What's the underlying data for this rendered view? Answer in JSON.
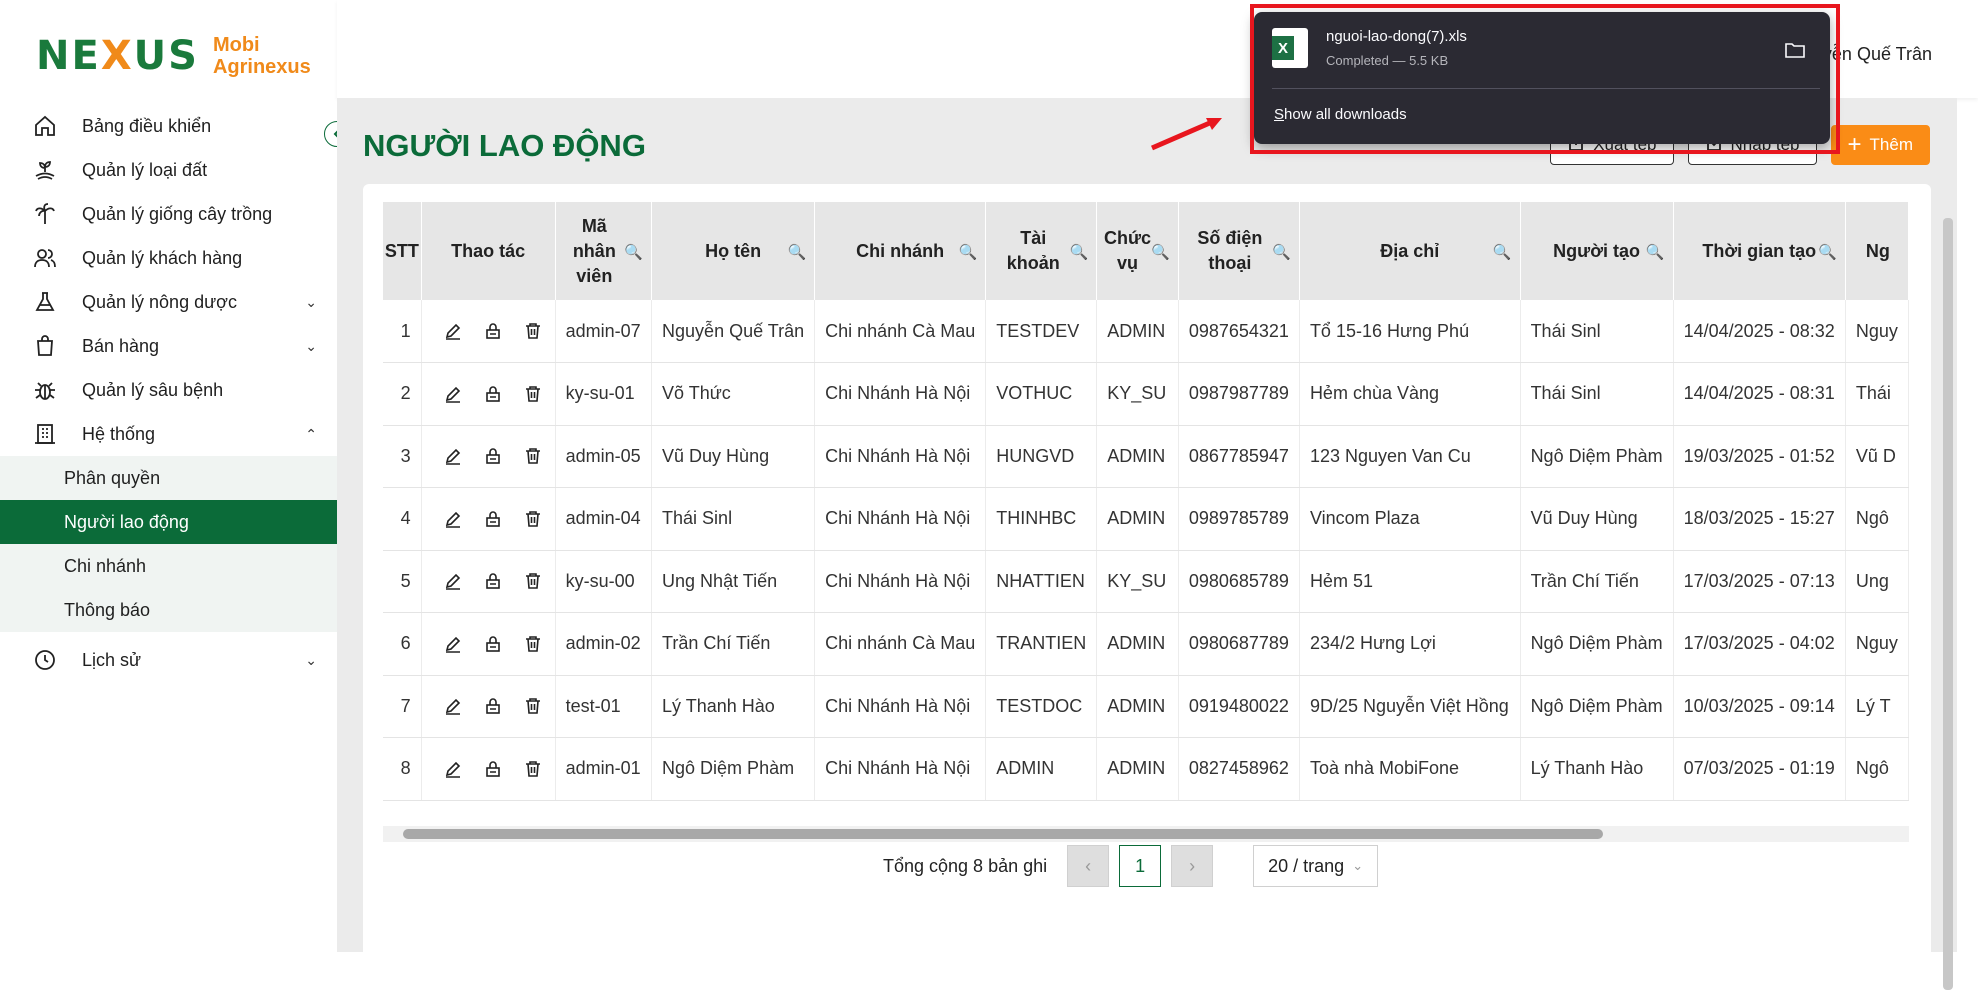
{
  "brand": {
    "mark_left": "NE",
    "mark_x": "X",
    "mark_right": "US",
    "line1": "Mobi",
    "line2": "Agrinexus"
  },
  "sidebar": {
    "items": [
      {
        "label": "Bảng điều khiển",
        "icon": "home-icon"
      },
      {
        "label": "Quản lý loại đất",
        "icon": "soil-icon"
      },
      {
        "label": "Quản lý giống cây trồng",
        "icon": "palm-icon"
      },
      {
        "label": "Quản lý khách hàng",
        "icon": "users-icon"
      },
      {
        "label": "Quản lý nông dược",
        "icon": "flask-icon",
        "chevron": "⌄"
      },
      {
        "label": "Bán hàng",
        "icon": "shopping-bag-icon",
        "chevron": "⌄"
      },
      {
        "label": "Quản lý sâu bệnh",
        "icon": "bug-icon"
      },
      {
        "label": "Hệ thống",
        "icon": "building-icon",
        "chevron": "⌃"
      }
    ],
    "sub_items": [
      {
        "label": "Phân quyền",
        "active": false
      },
      {
        "label": "Người lao động",
        "active": true
      },
      {
        "label": "Chi nhánh",
        "active": false
      },
      {
        "label": "Thông báo",
        "active": false
      }
    ],
    "history": {
      "label": "Lịch sử",
      "icon": "clock-icon",
      "chevron": "⌄"
    }
  },
  "header": {
    "user_name": "yễn Quế Trân"
  },
  "page": {
    "title": "NGƯỜI LAO ĐỘNG",
    "export_label": "Xuất tệp",
    "import_label": "Nhập tệp",
    "add_label": "Thêm"
  },
  "table": {
    "columns": [
      "STT",
      "Thao tác",
      "Mã nhân viên",
      "Họ tên",
      "Chi nhánh",
      "Tài khoản",
      "Chức vụ",
      "Số điện thoại",
      "Địa chỉ",
      "Người tạo",
      "Thời gian tạo",
      "Ng"
    ],
    "rows": [
      [
        "1",
        "admin-07",
        "Nguyễn Quế Trân",
        "Chi nhánh Cà Mau",
        "TESTDEV",
        "ADMIN",
        "0987654321",
        "Tổ 15-16 Hưng Phú",
        "Thái Sinl",
        "14/04/2025 - 08:32",
        "Nguy"
      ],
      [
        "2",
        "ky-su-01",
        "Võ Thức",
        "Chi Nhánh Hà Nội",
        "VOTHUC",
        "KY_SU",
        "0987987789",
        "Hẻm chùa Vàng",
        "Thái Sinl",
        "14/04/2025 - 08:31",
        "Thái"
      ],
      [
        "3",
        "admin-05",
        "Vũ Duy Hùng",
        "Chi Nhánh Hà Nội",
        "HUNGVD",
        "ADMIN",
        "0867785947",
        "123 Nguyen Van Cu",
        "Ngô Diệm Phàm",
        "19/03/2025 - 01:52",
        "Vũ D"
      ],
      [
        "4",
        "admin-04",
        "Thái Sinl",
        "Chi Nhánh Hà Nội",
        "THINHBC",
        "ADMIN",
        "0989785789",
        "Vincom Plaza",
        "Vũ Duy Hùng",
        "18/03/2025 - 15:27",
        "Ngô"
      ],
      [
        "5",
        "ky-su-00",
        "Ung Nhật Tiến",
        "Chi Nhánh Hà Nội",
        "NHATTIEN",
        "KY_SU",
        "0980685789",
        "Hẻm 51",
        "Trần Chí Tiến",
        "17/03/2025 - 07:13",
        "Ung"
      ],
      [
        "6",
        "admin-02",
        "Trần Chí Tiến",
        "Chi nhánh Cà Mau",
        "TRANTIEN",
        "ADMIN",
        "0980687789",
        "234/2 Hưng Lợi",
        "Ngô Diệm Phàm",
        "17/03/2025 - 04:02",
        "Nguy"
      ],
      [
        "7",
        "test-01",
        "Lý Thanh Hào",
        "Chi Nhánh Hà Nội",
        "TESTDOC",
        "ADMIN",
        "0919480022",
        "9D/25 Nguyễn Việt Hồng",
        "Ngô Diệm Phàm",
        "10/03/2025 - 09:14",
        "Lý T"
      ],
      [
        "8",
        "admin-01",
        "Ngô Diệm Phàm",
        "Chi Nhánh Hà Nội",
        "ADMIN",
        "ADMIN",
        "0827458962",
        "Toà nhà MobiFone",
        "Lý Thanh Hào",
        "07/03/2025 - 01:19",
        "Ngô"
      ]
    ]
  },
  "pagination": {
    "total_text": "Tổng cộng 8 bản ghi",
    "current_page": "1",
    "page_size": "20 / trang",
    "prev": "‹",
    "next": "›"
  },
  "download": {
    "file_name": "nguoi-lao-dong(7).xls",
    "status": "Completed — 5.5 KB",
    "show_all_access_key": "S",
    "show_all_rest": "how all downloads",
    "icon": "excel-file-icon"
  },
  "colors": {
    "brand_green": "#0b6b39",
    "accent_orange": "#fa8c16",
    "annotation_red": "#e8161e"
  }
}
